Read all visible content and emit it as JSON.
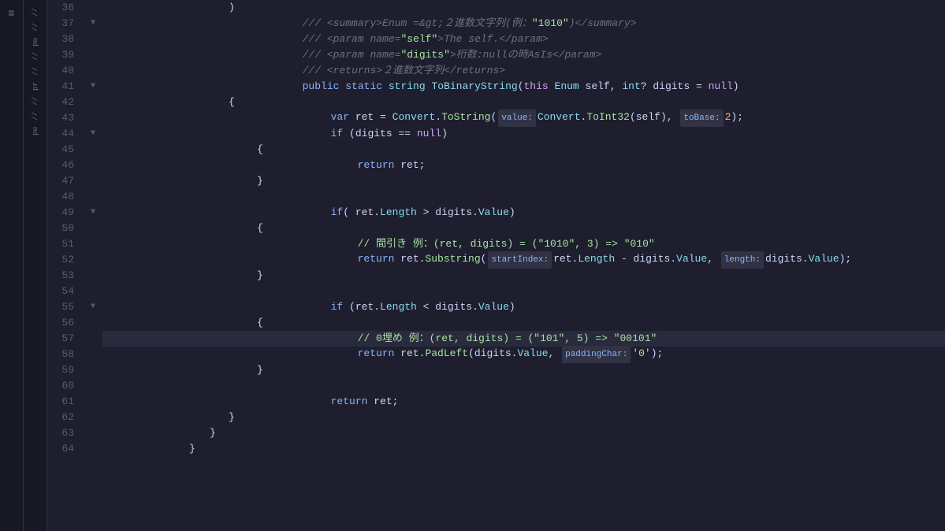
{
  "editor": {
    "background": "#1e1e2e",
    "lines": [
      {
        "num": 36,
        "fold": false,
        "indent": 3,
        "content": [],
        "raw": ")"
      },
      {
        "num": 37,
        "fold": true,
        "indent": 3,
        "content": [],
        "raw": "/// <summary>Enum =&gt;２進数文字列(例：\"1010\")</summary>"
      },
      {
        "num": 38,
        "fold": false,
        "indent": 3,
        "content": [],
        "raw": "/// <param name=\"self\">The self.</param>"
      },
      {
        "num": 39,
        "fold": false,
        "indent": 3,
        "content": [],
        "raw": "/// <param name=\"digits\">桁数:nullの時AsIs</param>"
      },
      {
        "num": 40,
        "fold": false,
        "indent": 3,
        "content": [],
        "raw": "/// <returns>２進数文字列</returns>"
      },
      {
        "num": 41,
        "fold": true,
        "indent": 3,
        "content": [],
        "raw": "public static string ToBinaryString(this Enum self, int? digits = null)"
      },
      {
        "num": 42,
        "fold": false,
        "indent": 3,
        "content": [],
        "raw": "{"
      },
      {
        "num": 43,
        "fold": false,
        "indent": 4,
        "content": [],
        "raw": "    var ret = Convert.ToString(value:Convert.ToInt32(self), toBase:2);"
      },
      {
        "num": 44,
        "fold": true,
        "indent": 4,
        "content": [],
        "raw": "    if (digits == null)"
      },
      {
        "num": 45,
        "fold": false,
        "indent": 4,
        "content": [],
        "raw": "    {"
      },
      {
        "num": 46,
        "fold": false,
        "indent": 5,
        "content": [],
        "raw": "        return ret;"
      },
      {
        "num": 47,
        "fold": false,
        "indent": 4,
        "content": [],
        "raw": "    }"
      },
      {
        "num": 48,
        "fold": false,
        "indent": 0,
        "content": [],
        "raw": ""
      },
      {
        "num": 49,
        "fold": true,
        "indent": 4,
        "content": [],
        "raw": "    if( ret.Length > digits.Value)"
      },
      {
        "num": 50,
        "fold": false,
        "indent": 4,
        "content": [],
        "raw": "    {"
      },
      {
        "num": 51,
        "fold": false,
        "indent": 5,
        "content": [],
        "raw": "        // 間引き 例：(ret, digits) = (\"1010\", 3) => \"010\""
      },
      {
        "num": 52,
        "fold": false,
        "indent": 5,
        "content": [],
        "raw": "        return ret.Substring(startIndex:ret.Length - digits.Value, length:digits.Value);"
      },
      {
        "num": 53,
        "fold": false,
        "indent": 4,
        "content": [],
        "raw": "    }"
      },
      {
        "num": 54,
        "fold": false,
        "indent": 0,
        "content": [],
        "raw": ""
      },
      {
        "num": 55,
        "fold": true,
        "indent": 4,
        "content": [],
        "raw": "    if (ret.Length < digits.Value)"
      },
      {
        "num": 56,
        "fold": false,
        "indent": 4,
        "content": [],
        "raw": "    {"
      },
      {
        "num": 57,
        "fold": false,
        "indent": 5,
        "highlight": true,
        "content": [],
        "raw": "        // 0埋め 例：(ret, digits) = (\"101\", 5) => \"00101\""
      },
      {
        "num": 58,
        "fold": false,
        "indent": 5,
        "content": [],
        "raw": "        return ret.PadLeft(digits.Value, paddingChar:'0');"
      },
      {
        "num": 59,
        "fold": false,
        "indent": 4,
        "content": [],
        "raw": "    }"
      },
      {
        "num": 60,
        "fold": false,
        "indent": 0,
        "content": [],
        "raw": ""
      },
      {
        "num": 61,
        "fold": false,
        "indent": 4,
        "content": [],
        "raw": "    return ret;"
      },
      {
        "num": 62,
        "fold": false,
        "indent": 3,
        "content": [],
        "raw": "}"
      },
      {
        "num": 63,
        "fold": false,
        "indent": 3,
        "content": [],
        "raw": "}"
      },
      {
        "num": 64,
        "fold": false,
        "indent": 2,
        "content": [],
        "raw": "}"
      }
    ]
  },
  "sidebar": {
    "items": [
      "//",
      "//",
      "pu",
      "//",
      "//",
      "pr",
      "//",
      "//",
      "pu"
    ]
  }
}
